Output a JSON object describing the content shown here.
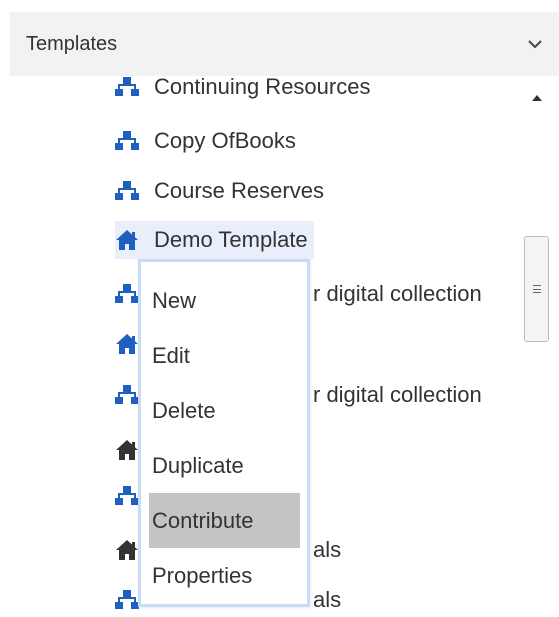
{
  "panel": {
    "title": "Templates",
    "toggle_icon": "chevron-down-icon"
  },
  "tree": {
    "items": [
      {
        "label": "Continuing Resources",
        "icon": "hierarchy-icon"
      },
      {
        "label": "Copy OfBooks",
        "icon": "hierarchy-icon"
      },
      {
        "label": "Course Reserves",
        "icon": "hierarchy-icon"
      },
      {
        "label": "Demo Template",
        "icon": "home-icon",
        "selected": true
      },
      {
        "label": "r digital collection",
        "icon": "hierarchy-icon"
      },
      {
        "label": "",
        "icon": "home-icon"
      },
      {
        "label": "r digital collection",
        "icon": "hierarchy-icon"
      },
      {
        "label": "",
        "icon": "home-icon-dark"
      },
      {
        "label": "",
        "icon": "hierarchy-icon"
      },
      {
        "label": "als",
        "icon": "home-icon-dark"
      },
      {
        "label": "als",
        "icon": "hierarchy-icon"
      }
    ]
  },
  "context_menu": {
    "items": [
      {
        "label": "New"
      },
      {
        "label": "Edit"
      },
      {
        "label": "Delete"
      },
      {
        "label": "Duplicate"
      },
      {
        "label": "Contribute",
        "highlighted": true
      },
      {
        "label": "Properties"
      }
    ]
  },
  "colors": {
    "icon_blue": "#1f5fbf",
    "icon_dark": "#333333",
    "header_bg": "#f2f2f2",
    "selected_bg": "#e8effb",
    "menu_border": "#c9dcf7",
    "menu_highlight": "#c4c4c4"
  }
}
